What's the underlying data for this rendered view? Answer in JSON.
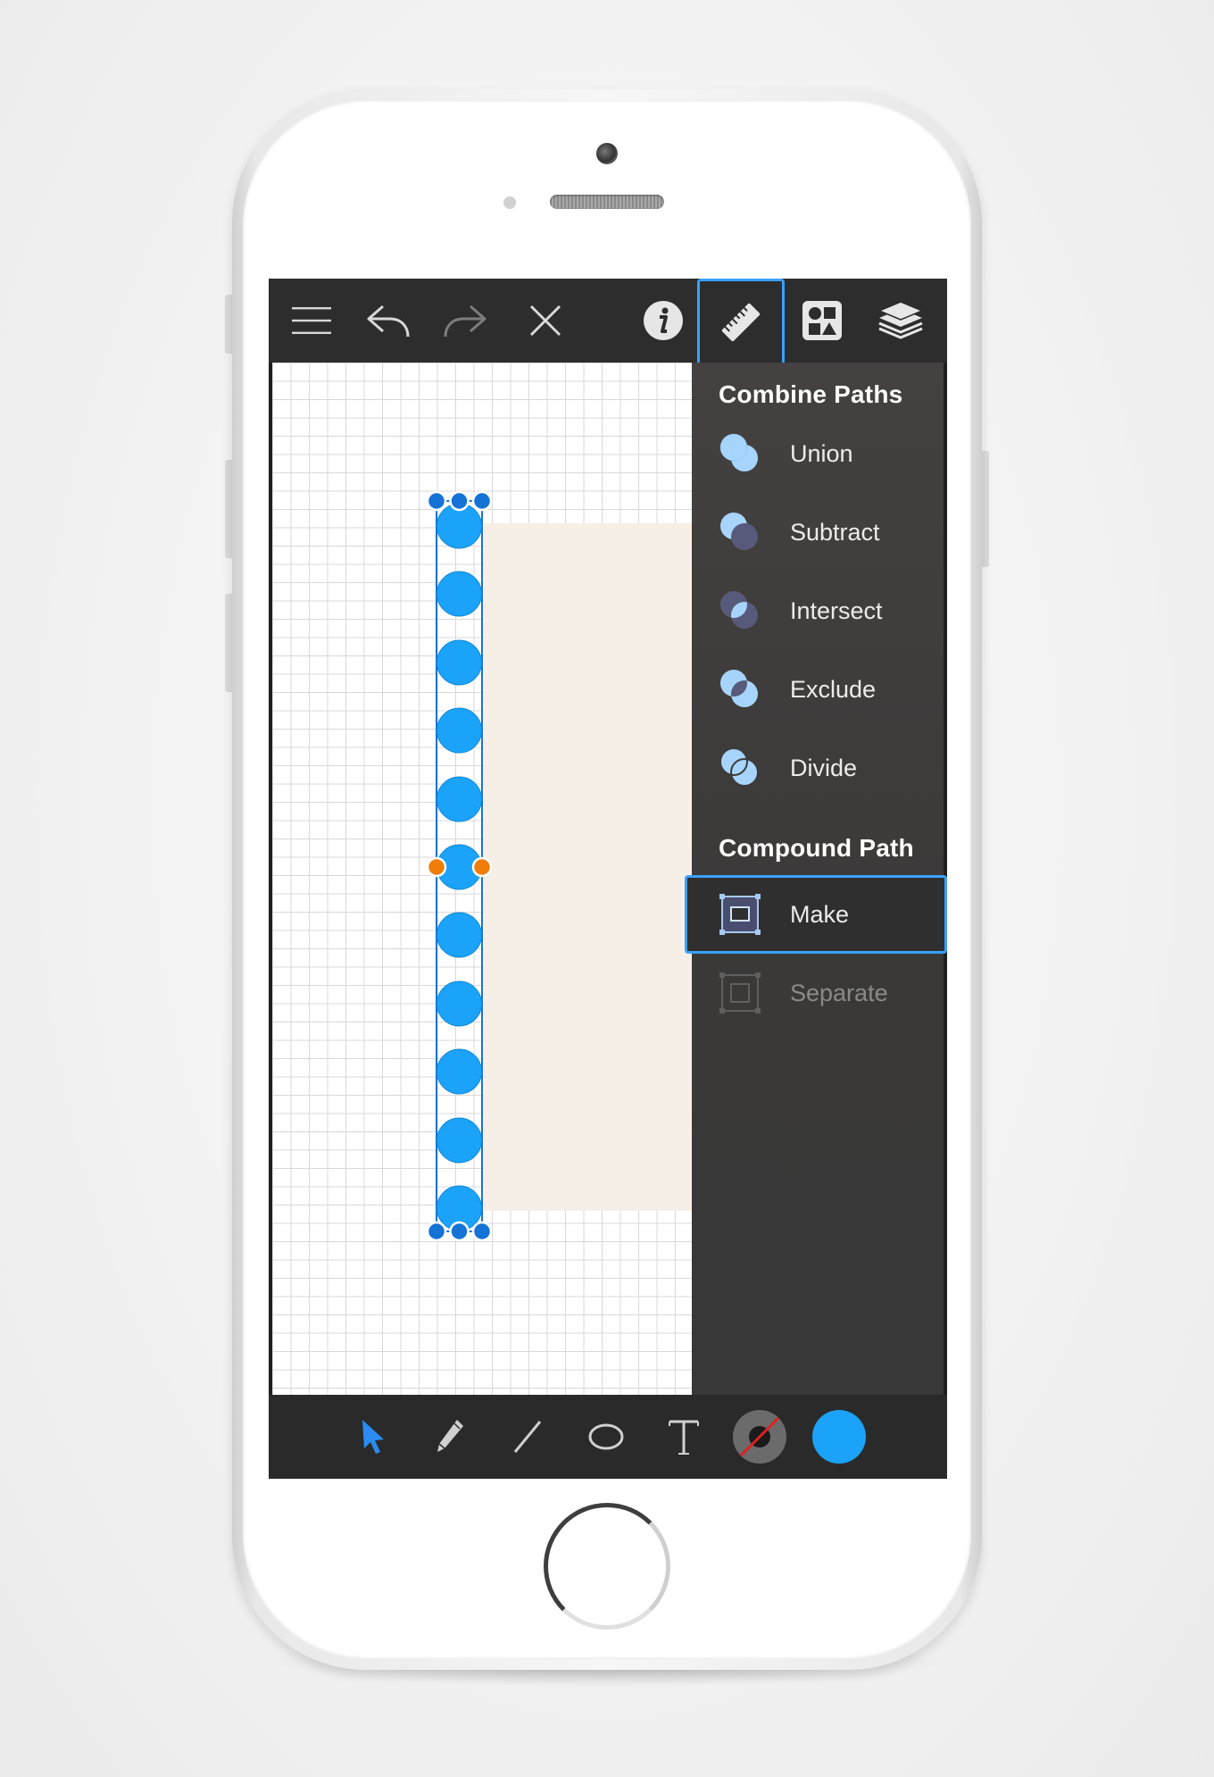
{
  "toolbar": {
    "left_icons": [
      "menu-icon",
      "undo-icon",
      "redo-icon",
      "close-icon"
    ],
    "right_icons": [
      "info-icon",
      "ruler-icon",
      "shapes-icon",
      "layers-icon"
    ],
    "selected": "ruler-icon"
  },
  "panel": {
    "combine_heading": "Combine Paths",
    "combine_items": [
      {
        "label": "Union",
        "icon": "union-icon"
      },
      {
        "label": "Subtract",
        "icon": "subtract-icon"
      },
      {
        "label": "Intersect",
        "icon": "intersect-icon"
      },
      {
        "label": "Exclude",
        "icon": "exclude-icon"
      },
      {
        "label": "Divide",
        "icon": "divide-icon"
      }
    ],
    "compound_heading": "Compound Path",
    "compound_items": [
      {
        "label": "Make",
        "icon": "make-compound-icon",
        "state": "highlighted"
      },
      {
        "label": "Separate",
        "icon": "separate-compound-icon",
        "state": "disabled"
      }
    ]
  },
  "tools": {
    "items": [
      "select-arrow-icon",
      "pencil-icon",
      "line-icon",
      "ellipse-icon",
      "text-icon",
      "stroke-color-swatch",
      "fill-color-swatch"
    ],
    "active": "select-arrow-icon"
  },
  "colors": {
    "accent": "#3aa0ff",
    "fill": "#1aa3f8",
    "handle_orange": "#f07d0a",
    "beige": "#f6efe6",
    "panel_bg": "#3d3b3a"
  }
}
